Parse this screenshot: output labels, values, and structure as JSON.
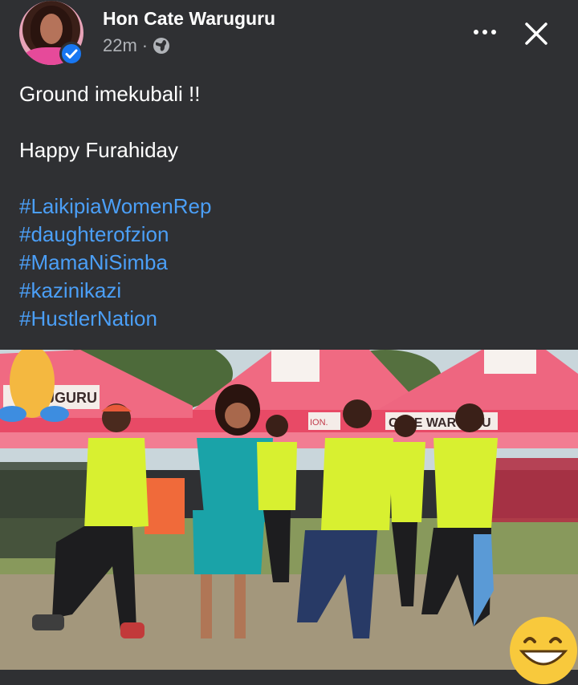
{
  "post": {
    "author": "Hon Cate Waruguru",
    "time": "22m",
    "separator": "·",
    "privacy_icon": "globe-icon",
    "verified_icon": "verified-check-icon",
    "lines": {
      "line1": "Ground imekubali !!",
      "line2": "Happy Furahiday"
    },
    "hashtags": [
      "#LaikipiaWomenRep",
      "#daughterofzion",
      "#MamaNiSimba",
      "#kazinikazi",
      "#HustlerNation"
    ]
  },
  "header_actions": {
    "more_icon": "more-horizontal-icon",
    "close_icon": "close-icon"
  },
  "media": {
    "tent_banner_left": "JGURU",
    "tent_banner_center": "ION.",
    "tent_banner_right": "CATE WARU",
    "tent_banner_right2": "U"
  },
  "colors": {
    "background": "#2f3033",
    "hashtag": "#4b9ff7",
    "verified": "#1877f2",
    "tent_pink": "#f06a82",
    "vest": "#d8f030",
    "dress": "#1aa3a8"
  }
}
